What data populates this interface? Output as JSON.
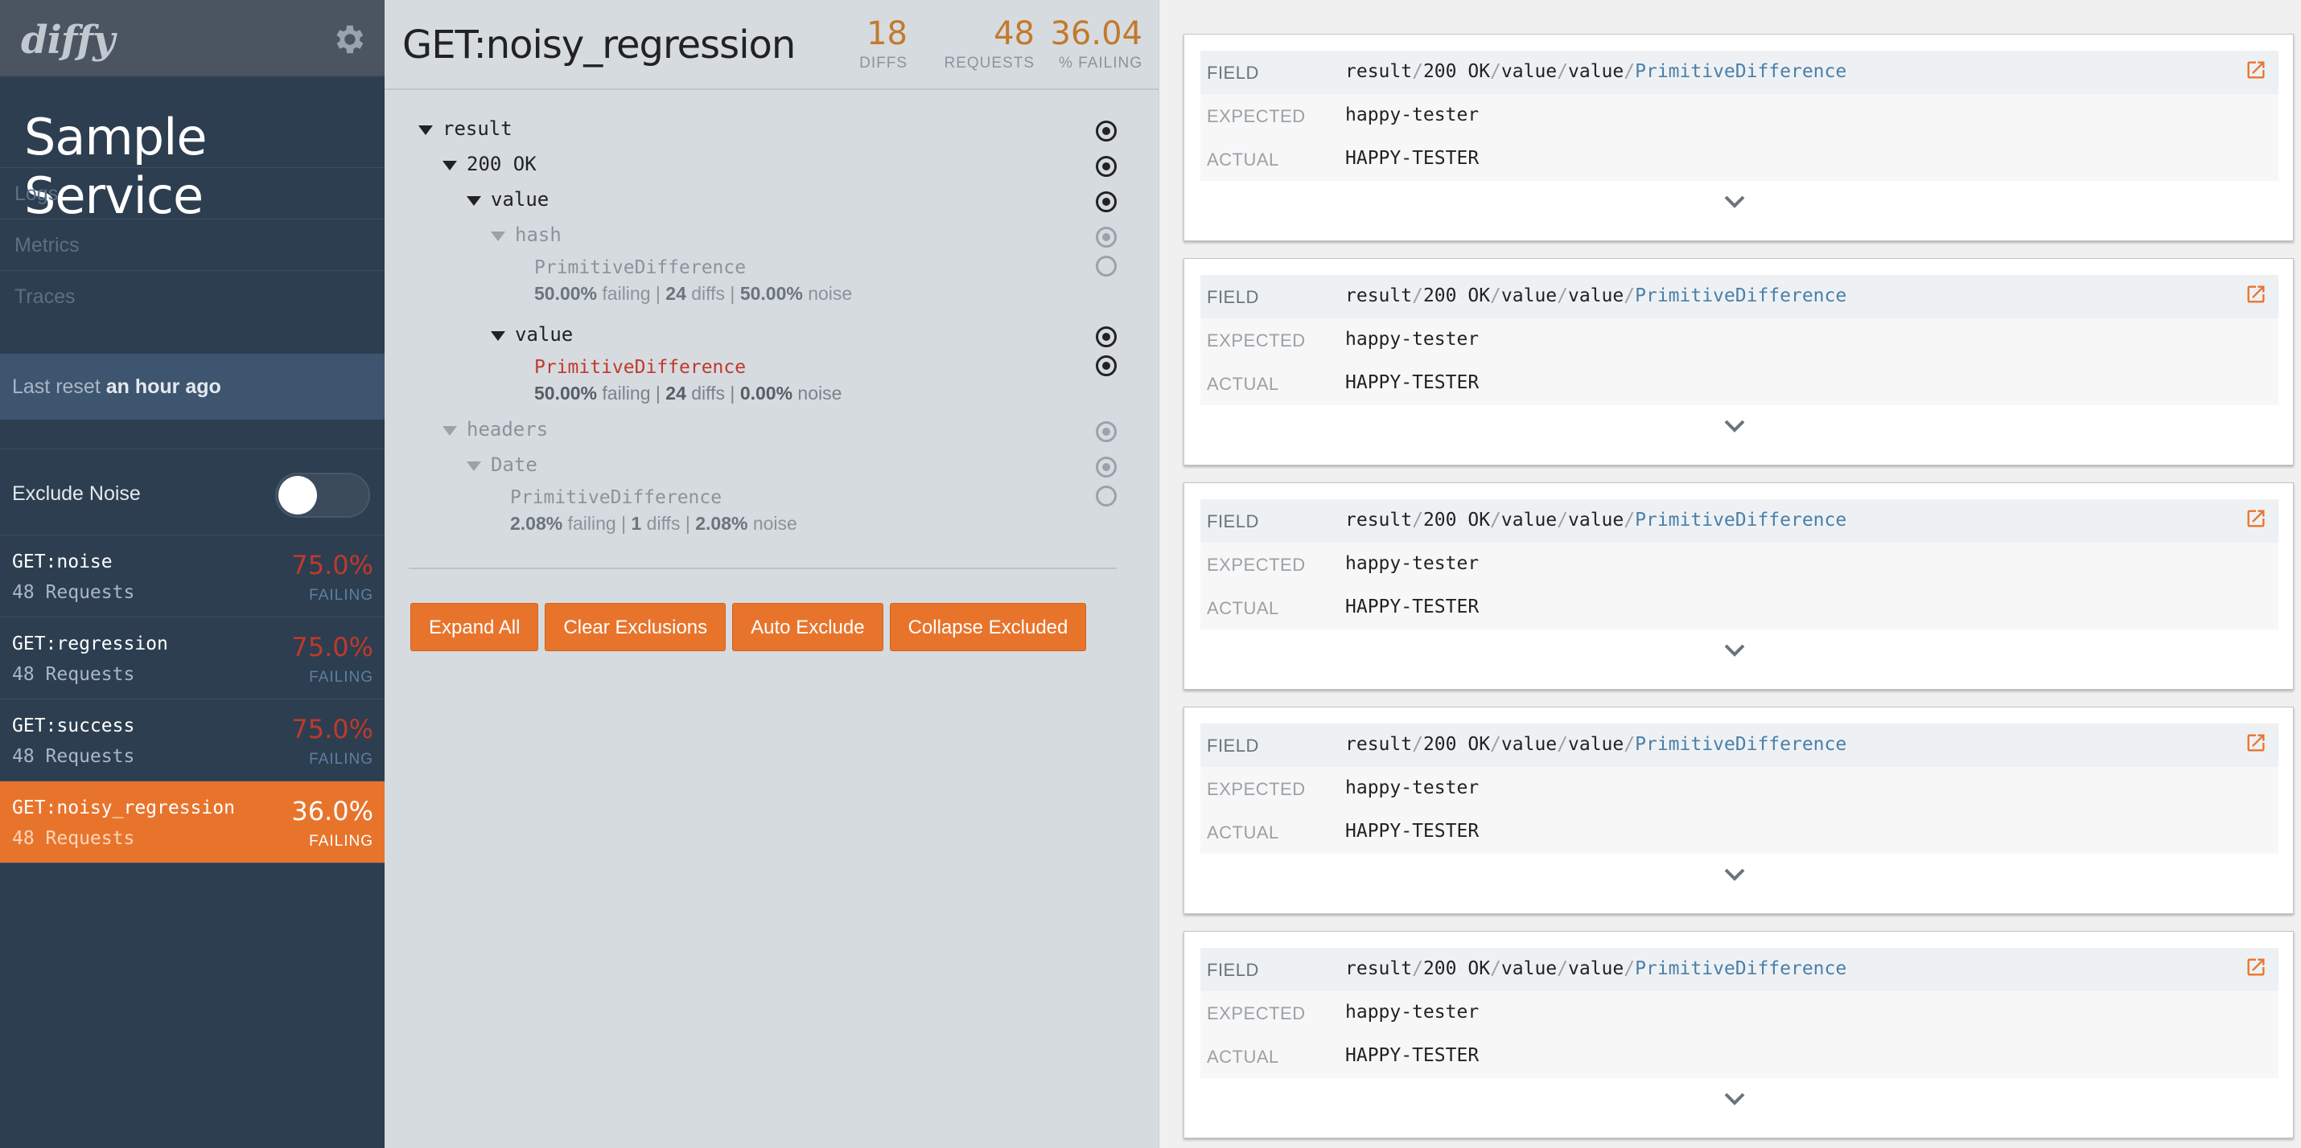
{
  "sidebar": {
    "logo": "diffy",
    "service_title": "Sample Service",
    "nav": [
      "Logs",
      "Metrics",
      "Traces"
    ],
    "reset_label": "Last reset",
    "reset_value": "an hour ago",
    "exclude_noise_label": "Exclude Noise",
    "exclude_noise_on": false,
    "endpoints": [
      {
        "name": "GET:noise",
        "requests": "48 Requests",
        "pct": "75.0%",
        "status": "FAILING",
        "active": false
      },
      {
        "name": "GET:regression",
        "requests": "48 Requests",
        "pct": "75.0%",
        "status": "FAILING",
        "active": false
      },
      {
        "name": "GET:success",
        "requests": "48 Requests",
        "pct": "75.0%",
        "status": "FAILING",
        "active": false
      },
      {
        "name": "GET:noisy_regression",
        "requests": "48 Requests",
        "pct": "36.0%",
        "status": "FAILING",
        "active": true
      }
    ]
  },
  "middle": {
    "title": "GET:noisy_regression",
    "stats": [
      {
        "num": "18",
        "label": "DIFFS"
      },
      {
        "num": "48",
        "label": "REQUESTS"
      },
      {
        "num": "36.04",
        "label": "% FAILING"
      }
    ],
    "tree": {
      "result": "result",
      "ok": "200 OK",
      "value": "value",
      "hash": "hash",
      "hash_leaf": {
        "name": "PrimitiveDifference",
        "failing": "50.00%",
        "failing_word": "failing",
        "diffs": "24",
        "diffs_word": "diffs",
        "noise": "50.00%",
        "noise_word": "noise"
      },
      "value2": "value",
      "value_leaf": {
        "name": "PrimitiveDifference",
        "failing": "50.00%",
        "failing_word": "failing",
        "diffs": "24",
        "diffs_word": "diffs",
        "noise": "0.00%",
        "noise_word": "noise"
      },
      "headers": "headers",
      "date": "Date",
      "date_leaf": {
        "name": "PrimitiveDifference",
        "failing": "2.08%",
        "failing_word": "failing",
        "diffs": "1",
        "diffs_word": "diffs",
        "noise": "2.08%",
        "noise_word": "noise"
      }
    },
    "buttons": [
      "Expand All",
      "Clear Exclusions",
      "Auto Exclude",
      "Collapse Excluded"
    ]
  },
  "right": {
    "labels": {
      "field": "FIELD",
      "expected": "EXPECTED",
      "actual": "ACTUAL"
    },
    "path": [
      "result",
      "200 OK",
      "value",
      "value",
      "PrimitiveDifference"
    ],
    "cards": [
      {
        "expected": "happy-tester",
        "actual": "HAPPY-TESTER"
      },
      {
        "expected": "happy-tester",
        "actual": "HAPPY-TESTER"
      },
      {
        "expected": "happy-tester",
        "actual": "HAPPY-TESTER"
      },
      {
        "expected": "happy-tester",
        "actual": "HAPPY-TESTER"
      },
      {
        "expected": "happy-tester",
        "actual": "HAPPY-TESTER"
      }
    ]
  },
  "colors": {
    "sidebar_bg": "#2c3e50",
    "accent": "#e8742c",
    "failing_red": "#c0392b",
    "stat_orange": "#c27a2c",
    "path_blue": "#4a7fa8"
  }
}
